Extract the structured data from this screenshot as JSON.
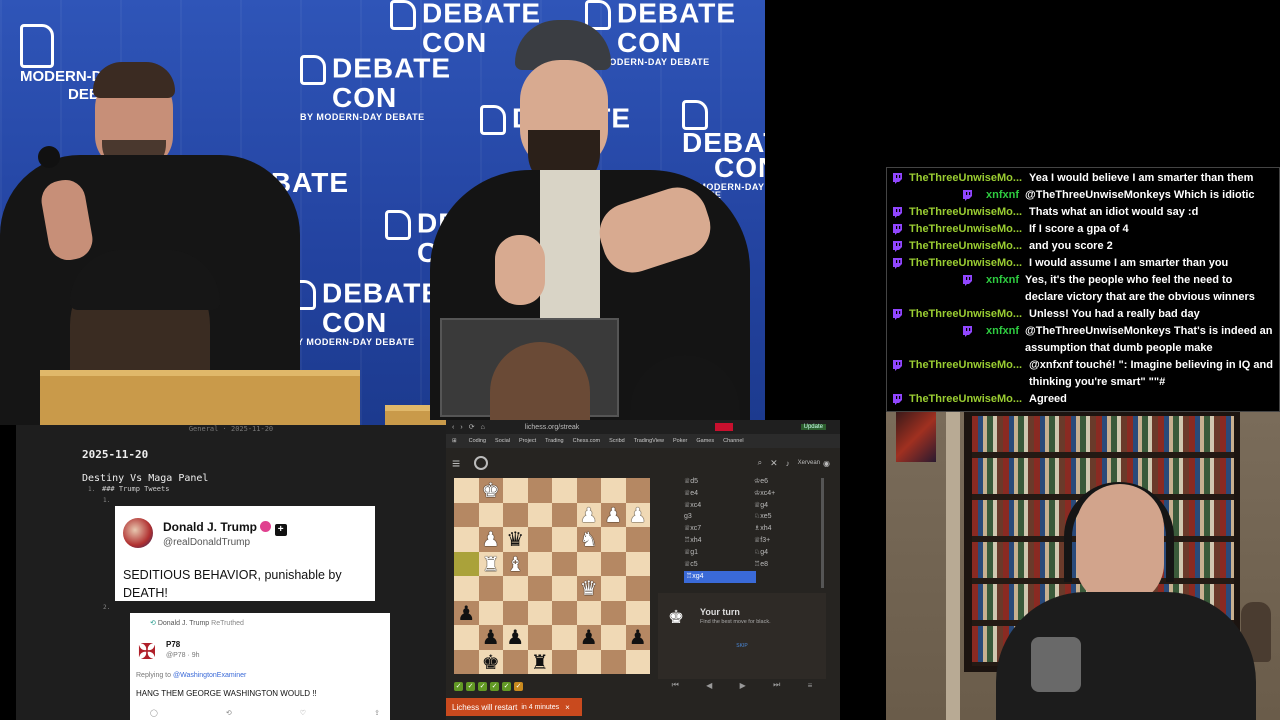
{
  "video": {
    "mdd_logo_line1": "MODERN-DAY",
    "mdd_logo_line2": "DEBATE",
    "banner_word1": "DEBATE",
    "banner_word2": "CON",
    "banner_sub": "BY MODERN-DAY DEBATE"
  },
  "chat": {
    "messages": [
      {
        "user": "TheThreeUnwiseMo...",
        "text": "Yea I would believe I am smarter than them",
        "side": "left"
      },
      {
        "user": "xnfxnf",
        "text": "@TheThreeUnwiseMonkeys Which is idiotic",
        "side": "right"
      },
      {
        "user": "TheThreeUnwiseMo...",
        "text": "Thats what an idiot would say :d",
        "side": "left"
      },
      {
        "user": "TheThreeUnwiseMo...",
        "text": "If I score a gpa of 4",
        "side": "left"
      },
      {
        "user": "TheThreeUnwiseMo...",
        "text": "and you score 2",
        "side": "left"
      },
      {
        "user": "TheThreeUnwiseMo...",
        "text": "I would assume I am smarter than you",
        "side": "left"
      },
      {
        "user": "xnfxnf",
        "text": "Yes, it's the people who feel the need to declare victory that are the obvious winners",
        "side": "right"
      },
      {
        "user": "TheThreeUnwiseMo...",
        "text": "Unless! You had a really bad day",
        "side": "left"
      },
      {
        "user": "xnfxnf",
        "text": "@TheThreeUnwiseMonkeys That's is indeed an assumption that dumb people make",
        "side": "right"
      },
      {
        "user": "TheThreeUnwiseMo...",
        "text": "@xnfxnf touché! \": Imagine believing in IQ and thinking you're smart\" \"\"#",
        "side": "left"
      },
      {
        "user": "TheThreeUnwiseMo...",
        "text": "Agreed",
        "side": "left"
      }
    ],
    "colors": {
      "user1": "#9ACD32",
      "user2": "#2ECC40",
      "badge": "#9146FF"
    }
  },
  "notes": {
    "header": "General · 2025-11-20",
    "date": "2025-11-20",
    "title": "Destiny Vs Maga Panel",
    "subheading": "### Trump Tweets",
    "list_num1": "1.",
    "list_num2": "2.",
    "tweet1": {
      "name": "Donald J. Trump",
      "handle": "@realDonaldTrump",
      "body": "SEDITIOUS BEHAVIOR, punishable by DEATH!"
    },
    "tweet2": {
      "retruth_by": "Donald J. Trump",
      "retruth_label": "ReTruthed",
      "name": "P78",
      "handle": "@P78 · 9h",
      "replying_prefix": "Replying to",
      "replying_to": "@WashingtonExaminer",
      "body": "HANG THEM GEORGE WASHINGTON WOULD !!"
    }
  },
  "chess": {
    "url": "lichess.org/streak",
    "bookmarks": [
      "Coding",
      "Social",
      "Project",
      "Trading",
      "Chess.com",
      "Scribd",
      "TradingView",
      "Poker",
      "Games",
      "Channel"
    ],
    "username": "Xervean",
    "moves": [
      [
        "♕d5",
        "♔e6"
      ],
      [
        "♕e4",
        "♔xc4+"
      ],
      [
        "♕xc4",
        "♕g4"
      ],
      [
        "g3",
        "♘xe5"
      ],
      [
        "♕xc7",
        "♗xh4"
      ],
      [
        "♖xh4",
        "♕f3+"
      ],
      [
        "♕g1",
        "♘g4"
      ],
      [
        "♕c5",
        "♖e8"
      ]
    ],
    "current_move": "♖xg4",
    "your_turn_title": "Your turn",
    "your_turn_sub": "Find the best move for black.",
    "skip_label": "SKIP",
    "restart_text": "Lichess will restart",
    "restart_time": "in 4 minutes",
    "restart_close": "×",
    "update_label": "Update",
    "streak_checks": 6,
    "board": [
      [
        "",
        "K",
        "",
        "",
        "",
        "",
        "",
        ""
      ],
      [
        "",
        "",
        "",
        "",
        "",
        "P",
        "P",
        "P"
      ],
      [
        "",
        "P",
        "q",
        "",
        "",
        "N",
        "",
        ""
      ],
      [
        "",
        "R",
        "B",
        "",
        "",
        "",
        "",
        ""
      ],
      [
        "",
        "",
        "",
        "",
        "",
        "Q",
        "",
        ""
      ],
      [
        "p",
        "",
        "",
        "",
        "",
        "",
        "",
        ""
      ],
      [
        "",
        "p",
        "p",
        "",
        "",
        "p",
        "",
        "p"
      ],
      [
        "",
        "k",
        "",
        "r",
        "",
        "",
        "",
        ""
      ]
    ]
  }
}
